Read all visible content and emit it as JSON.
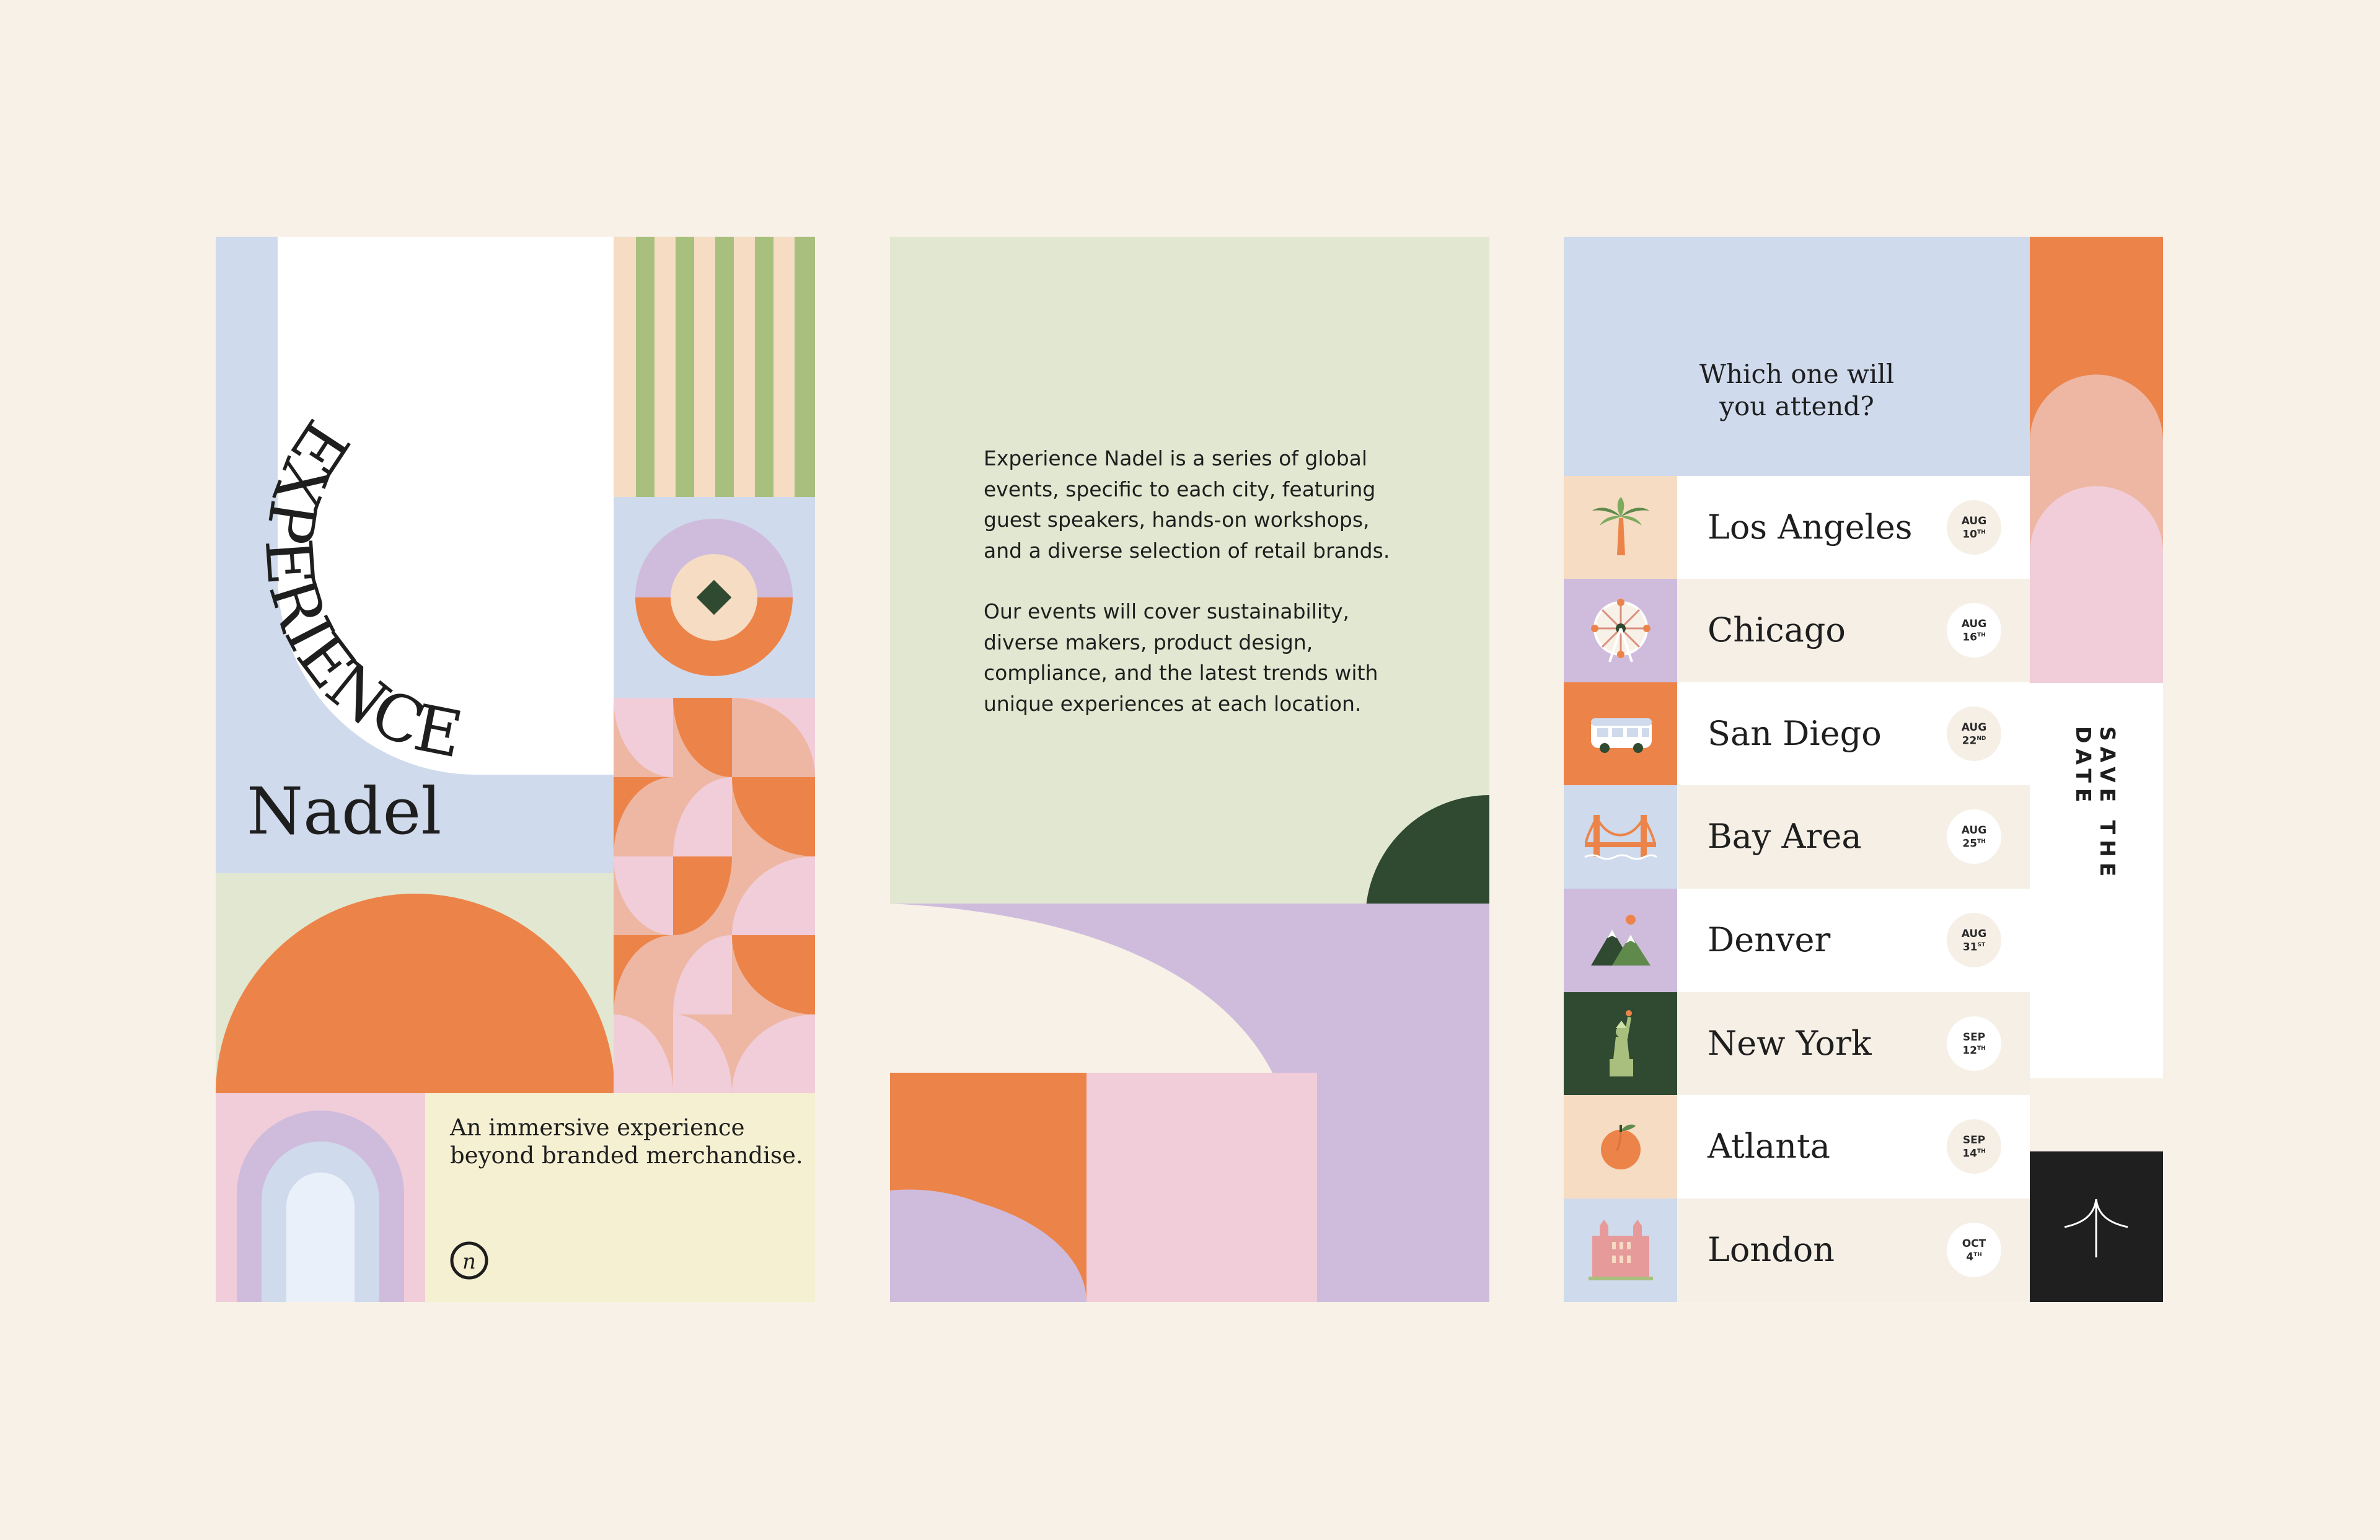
{
  "cover": {
    "experience_word": "EXPERIENCE",
    "nadel_word": "Nadel",
    "tagline_line1": "An immersive experience",
    "tagline_line2": "beyond branded merchandise.",
    "logo_letter": "n"
  },
  "info": {
    "paragraph1_lines": [
      "Experience Nadel is a series of global",
      "events, specific to each city, featuring",
      "guest speakers, hands-on workshops,",
      "and a diverse selection of retail brands."
    ],
    "paragraph2_lines": [
      "Our events will cover sustainability,",
      "diverse makers, product design,",
      "compliance, and the latest trends with",
      "unique experiences at each location."
    ]
  },
  "schedule": {
    "question_line1": "Which one will",
    "question_line2": "you attend?",
    "save_the_date": "SAVE THE DATE",
    "events": [
      {
        "city": "Los Angeles",
        "month": "AUG",
        "day": "10",
        "suffix": "TH",
        "icon": "palm-tree-icon"
      },
      {
        "city": "Chicago",
        "month": "AUG",
        "day": "16",
        "suffix": "TH",
        "icon": "ferris-wheel-icon"
      },
      {
        "city": "San Diego",
        "month": "AUG",
        "day": "22",
        "suffix": "ND",
        "icon": "camper-van-icon"
      },
      {
        "city": "Bay Area",
        "month": "AUG",
        "day": "25",
        "suffix": "TH",
        "icon": "golden-gate-bridge-icon"
      },
      {
        "city": "Denver",
        "month": "AUG",
        "day": "31",
        "suffix": "ST",
        "icon": "mountains-icon"
      },
      {
        "city": "New York",
        "month": "SEP",
        "day": "12",
        "suffix": "TH",
        "icon": "statue-of-liberty-icon"
      },
      {
        "city": "Atlanta",
        "month": "SEP",
        "day": "14",
        "suffix": "TH",
        "icon": "peach-icon"
      },
      {
        "city": "London",
        "month": "OCT",
        "day": "4",
        "suffix": "TH",
        "icon": "palace-building-icon"
      }
    ]
  },
  "colors": {
    "background": "#f8f1e7",
    "blue": "#cfdaec",
    "orange": "#ec844a",
    "pink": "#f1cdd9",
    "lavender": "#cfbcdd",
    "sage": "#e2e7d1",
    "green": "#a9bf7e",
    "dark_green": "#2f4a31",
    "peach": "#f5dcc3",
    "cream": "#f5f0d2",
    "salmon": "#edb7a4",
    "black": "#201f20"
  }
}
